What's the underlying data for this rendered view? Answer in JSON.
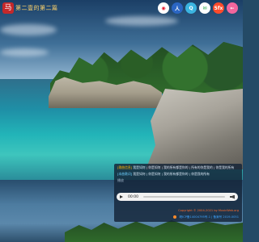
{
  "header": {
    "logo_text": "马",
    "site_title": "第二壹的第二篇",
    "icons": [
      {
        "name": "weibo-icon",
        "glyph": "◉",
        "bg": "#ffffff",
        "fg": "#e6162d"
      },
      {
        "name": "user-icon",
        "glyph": "人",
        "bg": "#2b66c3",
        "fg": "#ffffff"
      },
      {
        "name": "qq-icon",
        "glyph": "Q",
        "bg": "#3bb4e0",
        "fg": "#ffffff"
      },
      {
        "name": "wechat-icon",
        "glyph": "✉",
        "bg": "#ffffff",
        "fg": "#2aa94e"
      },
      {
        "name": "app-icon",
        "glyph": "5fx",
        "bg": "#ff4b2b",
        "fg": "#ffffff"
      },
      {
        "name": "back-icon",
        "glyph": "←",
        "bg": "#f2669d",
        "fg": "#ffffff"
      }
    ]
  },
  "panel": {
    "lyric_line_1_tag": "[歌曲信息]",
    "lyric_line_1_text": "我是如何 | 你是如何 | 我的所有都是你的 | 所有的你是我的 | 你是我的所有",
    "lyric_line_2_tag": "[本曲歌词]",
    "lyric_line_2_text": "我是如何 | 你是如何 | 我的所有都是你的 | 你是我的所有",
    "sub_label": "播放",
    "player_time": "00:00",
    "copyright": "Copyright © 2004-2021 by MusicWeb.org",
    "footer": "皖ICP备14004795号-1 | 备案号 2019-0051"
  },
  "colors": {
    "accent_title": "#ffd36b",
    "highlight_orange": "#ffb300",
    "copyright_orange": "#ff6a2b",
    "footer_blue": "#3fa3ff"
  }
}
